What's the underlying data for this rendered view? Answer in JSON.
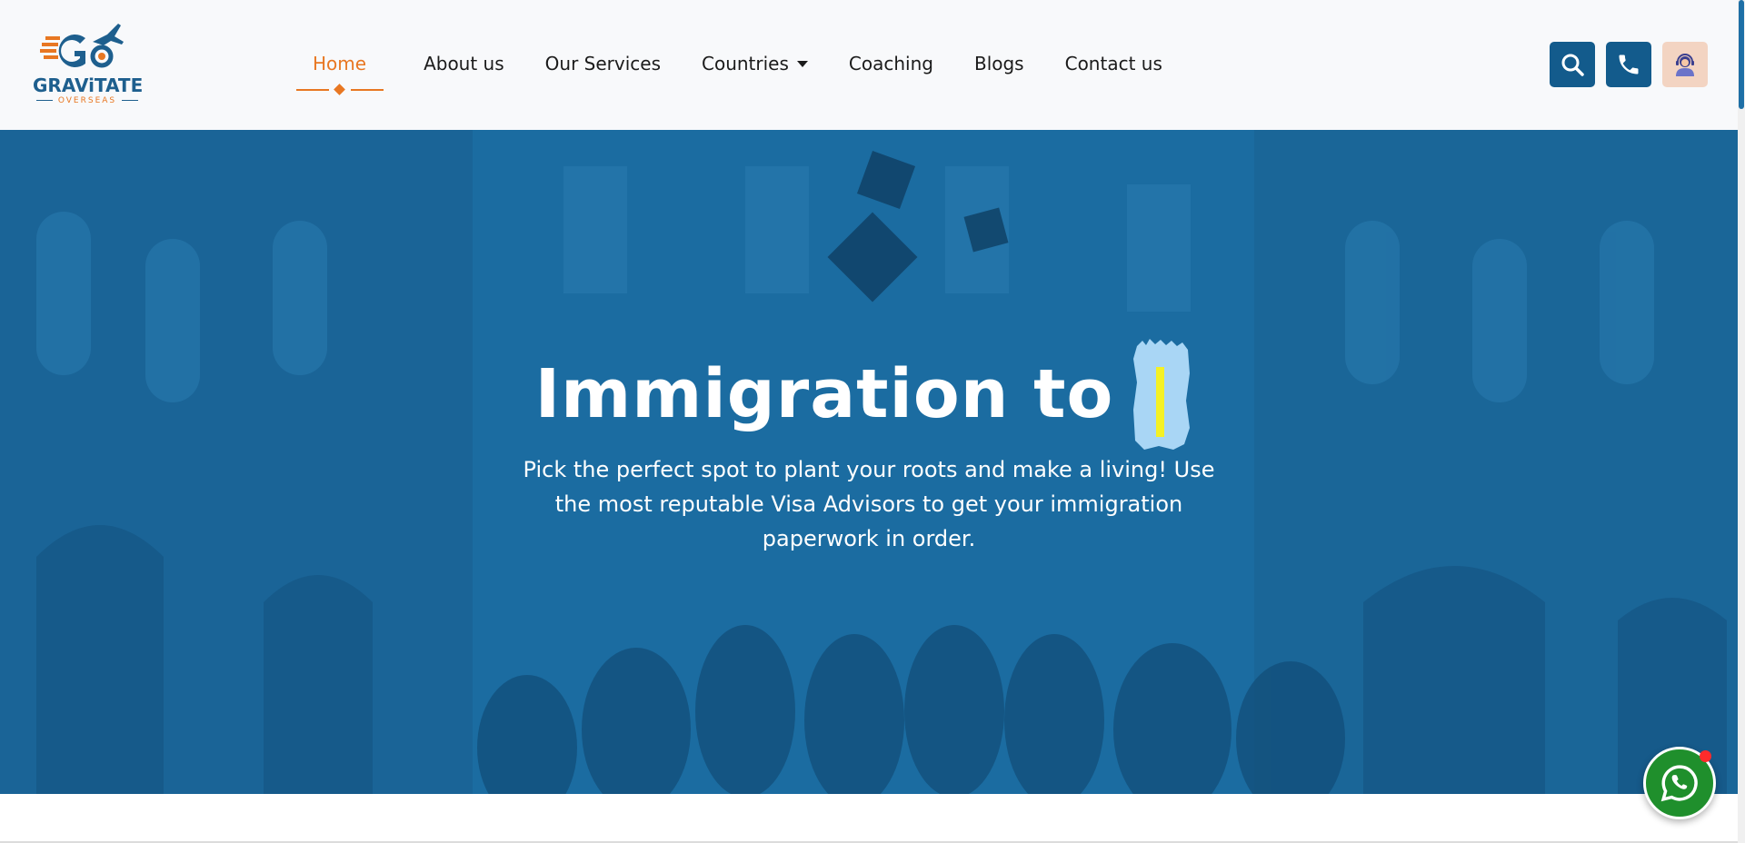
{
  "brand": {
    "name": "GRAViTATE",
    "tagline": "OVERSEAS",
    "logo_colors": {
      "primary": "#1e5f8e",
      "accent": "#e87722"
    }
  },
  "nav": {
    "items": [
      {
        "label": "Home",
        "active": true
      },
      {
        "label": "About us",
        "active": false
      },
      {
        "label": "Our Services",
        "active": false
      },
      {
        "label": "Countries",
        "active": false,
        "dropdown": true
      },
      {
        "label": "Coaching",
        "active": false
      },
      {
        "label": "Blogs",
        "active": false
      },
      {
        "label": "Contact us",
        "active": false
      }
    ],
    "active_color": "#e87722"
  },
  "header_actions": [
    {
      "icon": "search-icon",
      "color": "#135b8c"
    },
    {
      "icon": "phone-icon",
      "color": "#135b8c"
    },
    {
      "icon": "support-agent-icon",
      "color": "#f3d4c2"
    }
  ],
  "hero": {
    "title": "Immigration to",
    "description": "Pick the perfect spot to plant your roots and make a living! Use the most reputable Visa Advisors to get your immigration paperwork in order.",
    "overlay_color": "#1b6ca1",
    "cursor_color": "#f4f126"
  },
  "floating": {
    "whatsapp_icon": "whatsapp-icon",
    "color": "#1f8f2c",
    "notification_color": "#ff2b2b"
  }
}
